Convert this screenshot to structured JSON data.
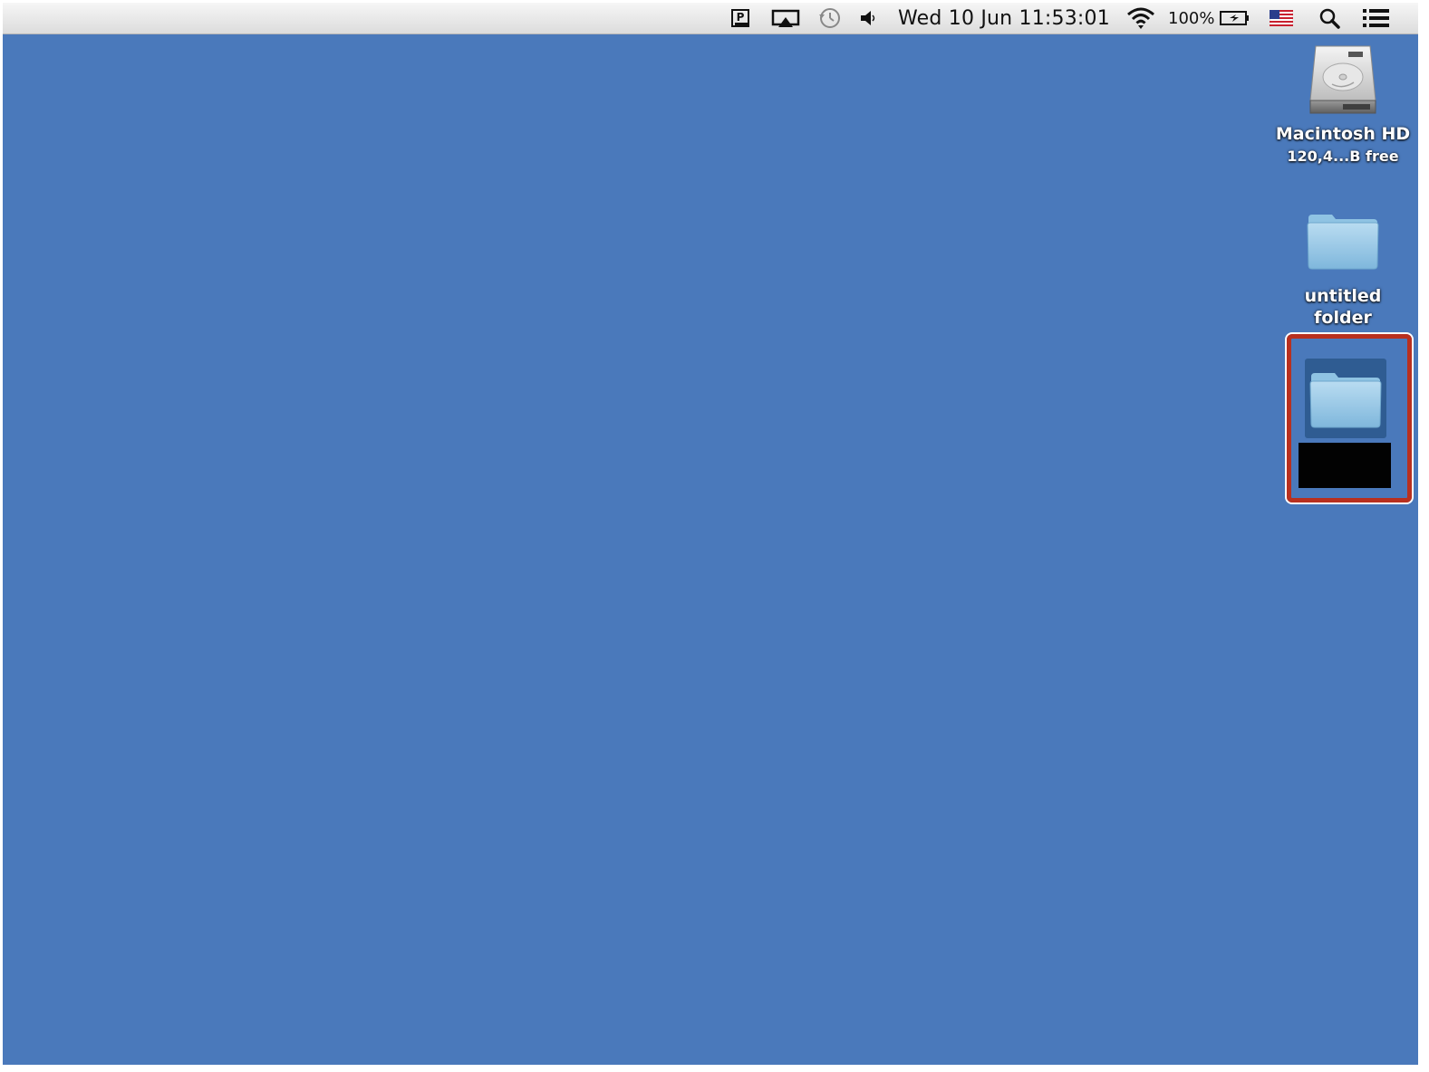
{
  "menubar": {
    "icons": {
      "app_icon": "pocket-p-icon",
      "airplay": "airplay-icon",
      "timemachine": "time-machine-icon",
      "volume": "volume-icon",
      "wifi": "wifi-icon",
      "battery": "battery-charging-icon",
      "flag": "us-flag-icon",
      "spotlight": "spotlight-search-icon",
      "notifications": "notification-center-icon"
    },
    "datetime": "Wed 10 Jun  11:53:01",
    "battery_percent": "100%"
  },
  "desktop": {
    "background_color": "#4a79bb",
    "icons": [
      {
        "name": "Macintosh HD",
        "subtitle": "120,4...B free",
        "icon": "hard-drive-icon"
      },
      {
        "name": "untitled folder",
        "icon": "folder-icon"
      },
      {
        "icon": "folder-icon",
        "selected": true
      }
    ]
  },
  "highlight_color": "#b8301f"
}
